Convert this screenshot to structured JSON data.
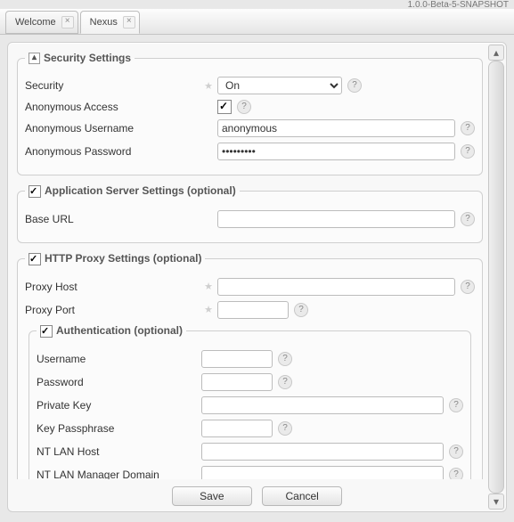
{
  "version": "1.0.0-Beta-5-SNAPSHOT",
  "tabs": [
    {
      "label": "Welcome",
      "active": false
    },
    {
      "label": "Nexus",
      "active": true
    }
  ],
  "security": {
    "title": "Security Settings",
    "security_label": "Security",
    "security_value": "On",
    "anon_access_label": "Anonymous Access",
    "anon_access_checked": true,
    "anon_user_label": "Anonymous Username",
    "anon_user_value": "anonymous",
    "anon_pass_label": "Anonymous Password",
    "anon_pass_value": "•••••••••"
  },
  "appserver": {
    "title": "Application Server Settings (optional)",
    "baseurl_label": "Base URL",
    "baseurl_value": ""
  },
  "proxy": {
    "title": "HTTP Proxy Settings (optional)",
    "host_label": "Proxy Host",
    "host_value": "",
    "port_label": "Proxy Port",
    "port_value": "",
    "auth": {
      "title": "Authentication (optional)",
      "user_label": "Username",
      "user_value": "",
      "pass_label": "Password",
      "pass_value": "",
      "privkey_label": "Private Key",
      "privkey_value": "",
      "passphrase_label": "Key Passphrase",
      "passphrase_value": "",
      "ntlan_host_label": "NT LAN Host",
      "ntlan_host_value": "",
      "ntlan_domain_label": "NT LAN Manager Domain",
      "ntlan_domain_value": ""
    }
  },
  "buttons": {
    "save": "Save",
    "cancel": "Cancel"
  }
}
